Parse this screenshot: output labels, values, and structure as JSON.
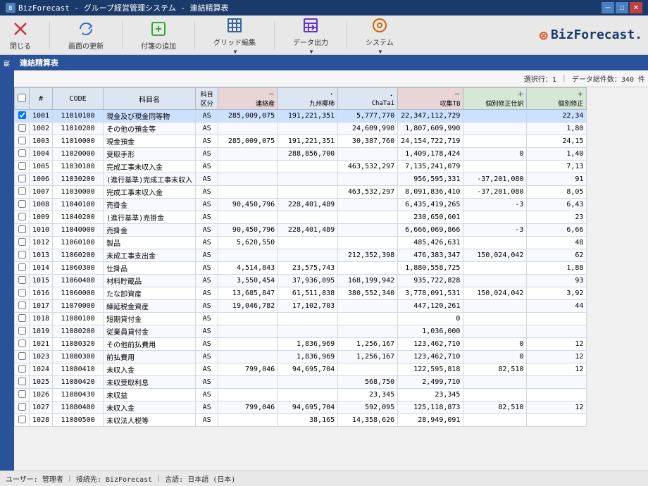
{
  "titleBar": {
    "title": "BizForecast - グループ経営管理システム - 連結精算表",
    "minBtn": "─",
    "maxBtn": "□",
    "closeBtn": "✕"
  },
  "toolbar": {
    "closeLabel": "閉じる",
    "refreshLabel": "画面の更新",
    "addLabel": "付箋の追加",
    "gridLabel": "グリッド編集",
    "exportLabel": "データ出力",
    "systemLabel": "システム",
    "logoText": "BizForecast."
  },
  "subHeader": {
    "title": "連結精算表"
  },
  "gridInfo": {
    "selectedRow": "選択行：1",
    "totalCount": "データ総件数：340 件"
  },
  "columns": {
    "check": "",
    "num": "#",
    "code": "CODE",
    "name": "科目名",
    "kubun": "科目区分",
    "renraku": "連絡産",
    "kyushu": "九州椰柿",
    "chatai": "ChaTai",
    "shuuhi": "収集TB",
    "kojin1": "個別修正仕訳",
    "kojin2": "個別修正"
  },
  "rows": [
    {
      "id": 1,
      "num": "1001",
      "code": "11010100",
      "name": "現金及び現金同等物",
      "kubun": "AS",
      "renraku": "285,009,075",
      "kyushu": "191,221,351",
      "chatai": "5,777,770",
      "shuuhi": "22,347,112,729",
      "kojin1": "",
      "kojin2": "22,34"
    },
    {
      "id": 2,
      "num": "1002",
      "code": "11010200",
      "name": "その他の預金等",
      "kubun": "AS",
      "renraku": "",
      "kyushu": "",
      "chatai": "24,609,990",
      "shuuhi": "1,807,609,990",
      "kojin1": "",
      "kojin2": "1,80"
    },
    {
      "id": 3,
      "num": "1003",
      "code": "11010000",
      "name": "現金預金",
      "kubun": "AS",
      "renraku": "285,009,075",
      "kyushu": "191,221,351",
      "chatai": "30,387,760",
      "shuuhi": "24,154,722,719",
      "kojin1": "",
      "kojin2": "24,15"
    },
    {
      "id": 4,
      "num": "1004",
      "code": "11020000",
      "name": "受取手形",
      "kubun": "AS",
      "renraku": "",
      "kyushu": "288,856,700",
      "chatai": "",
      "shuuhi": "1,409,178,424",
      "kojin1": "0",
      "kojin2": "1,40"
    },
    {
      "id": 5,
      "num": "1005",
      "code": "11030100",
      "name": "完成工事未収入金",
      "kubun": "AS",
      "renraku": "",
      "kyushu": "",
      "chatai": "463,532,297",
      "shuuhi": "7,135,241,079",
      "kojin1": "",
      "kojin2": "7,13"
    },
    {
      "id": 6,
      "num": "1006",
      "code": "11030200",
      "name": "(進行基準)完成工事未収入",
      "kubun": "AS",
      "renraku": "",
      "kyushu": "",
      "chatai": "",
      "shuuhi": "956,595,331",
      "kojin1": "-37,201,080",
      "kojin2": "91"
    },
    {
      "id": 7,
      "num": "1007",
      "code": "11030000",
      "name": "完成工事未収入金",
      "kubun": "AS",
      "renraku": "",
      "kyushu": "",
      "chatai": "463,532,297",
      "shuuhi": "8,091,836,410",
      "kojin1": "-37,201,080",
      "kojin2": "8,05"
    },
    {
      "id": 8,
      "num": "1008",
      "code": "11040100",
      "name": "売掛金",
      "kubun": "AS",
      "renraku": "90,450,796",
      "kyushu": "228,401,489",
      "chatai": "",
      "shuuhi": "6,435,419,265",
      "kojin1": "-3",
      "kojin2": "6,43"
    },
    {
      "id": 9,
      "num": "1009",
      "code": "11040200",
      "name": "(進行基準)売掛金",
      "kubun": "AS",
      "renraku": "",
      "kyushu": "",
      "chatai": "",
      "shuuhi": "230,650,601",
      "kojin1": "",
      "kojin2": "23"
    },
    {
      "id": 10,
      "num": "1010",
      "code": "11040000",
      "name": "売掛金",
      "kubun": "AS",
      "renraku": "90,450,796",
      "kyushu": "228,401,489",
      "chatai": "",
      "shuuhi": "6,666,069,866",
      "kojin1": "-3",
      "kojin2": "6,66"
    },
    {
      "id": 11,
      "num": "1012",
      "code": "11060100",
      "name": "製品",
      "kubun": "AS",
      "renraku": "5,620,550",
      "kyushu": "",
      "chatai": "",
      "shuuhi": "485,426,631",
      "kojin1": "",
      "kojin2": "48"
    },
    {
      "id": 12,
      "num": "1013",
      "code": "11060200",
      "name": "未成工事支出金",
      "kubun": "AS",
      "renraku": "",
      "kyushu": "",
      "chatai": "212,352,398",
      "shuuhi": "476,383,347",
      "kojin1": "150,024,042",
      "kojin2": "62"
    },
    {
      "id": 13,
      "num": "1014",
      "code": "11060300",
      "name": "仕掛品",
      "kubun": "AS",
      "renraku": "4,514,843",
      "kyushu": "23,575,743",
      "chatai": "",
      "shuuhi": "1,880,558,725",
      "kojin1": "",
      "kojin2": "1,88"
    },
    {
      "id": 14,
      "num": "1015",
      "code": "11060400",
      "name": "材料貯蔵品",
      "kubun": "AS",
      "renraku": "3,550,454",
      "kyushu": "37,936,095",
      "chatai": "168,199,942",
      "shuuhi": "935,722,828",
      "kojin1": "",
      "kojin2": "93"
    },
    {
      "id": 15,
      "num": "1016",
      "code": "11060000",
      "name": "たな卸資産",
      "kubun": "AS",
      "renraku": "13,685,847",
      "kyushu": "61,511,838",
      "chatai": "380,552,340",
      "shuuhi": "3,778,091,531",
      "kojin1": "150,024,042",
      "kojin2": "3,92"
    },
    {
      "id": 16,
      "num": "1017",
      "code": "11070000",
      "name": "繰延税金資産",
      "kubun": "AS",
      "renraku": "19,046,782",
      "kyushu": "17,102,703",
      "chatai": "",
      "shuuhi": "447,120,261",
      "kojin1": "",
      "kojin2": "44"
    },
    {
      "id": 17,
      "num": "1018",
      "code": "11080100",
      "name": "短期貸付金",
      "kubun": "AS",
      "renraku": "",
      "kyushu": "",
      "chatai": "",
      "shuuhi": "0",
      "kojin1": "",
      "kojin2": ""
    },
    {
      "id": 18,
      "num": "1019",
      "code": "11080200",
      "name": "従業員貸付金",
      "kubun": "AS",
      "renraku": "",
      "kyushu": "",
      "chatai": "",
      "shuuhi": "1,036,000",
      "kojin1": "",
      "kojin2": ""
    },
    {
      "id": 19,
      "num": "1021",
      "code": "11080320",
      "name": "その他前払費用",
      "kubun": "AS",
      "renraku": "",
      "kyushu": "1,836,969",
      "chatai": "1,256,167",
      "shuuhi": "123,462,710",
      "kojin1": "0",
      "kojin2": "12"
    },
    {
      "id": 20,
      "num": "1023",
      "code": "11080300",
      "name": "前払費用",
      "kubun": "AS",
      "renraku": "",
      "kyushu": "1,836,969",
      "chatai": "1,256,167",
      "shuuhi": "123,462,710",
      "kojin1": "0",
      "kojin2": "12"
    },
    {
      "id": 21,
      "num": "1024",
      "code": "11080410",
      "name": "未収入金",
      "kubun": "AS",
      "renraku": "799,046",
      "kyushu": "94,695,704",
      "chatai": "",
      "shuuhi": "122,595,818",
      "kojin1": "82,510",
      "kojin2": "12"
    },
    {
      "id": 22,
      "num": "1025",
      "code": "11080420",
      "name": "未収受取利息",
      "kubun": "AS",
      "renraku": "",
      "kyushu": "",
      "chatai": "568,750",
      "shuuhi": "2,499,710",
      "kojin1": "",
      "kojin2": ""
    },
    {
      "id": 23,
      "num": "1026",
      "code": "11080430",
      "name": "未収益",
      "kubun": "AS",
      "renraku": "",
      "kyushu": "",
      "chatai": "23,345",
      "shuuhi": "23,345",
      "kojin1": "",
      "kojin2": ""
    },
    {
      "id": 24,
      "num": "1027",
      "code": "11080400",
      "name": "未収入金",
      "kubun": "AS",
      "renraku": "799,046",
      "kyushu": "94,695,704",
      "chatai": "592,095",
      "shuuhi": "125,118,873",
      "kojin1": "82,510",
      "kojin2": "12"
    },
    {
      "id": 25,
      "num": "1028",
      "code": "11080500",
      "name": "未収法人税等",
      "kubun": "AS",
      "renraku": "",
      "kyushu": "38,165",
      "chatai": "14,358,626",
      "shuuhi": "28,949,091",
      "kojin1": "",
      "kojin2": ""
    }
  ],
  "statusBar": {
    "user": "ユーザー: 管理者",
    "connection": "接続先: BizForecast",
    "language": "言語: 日本語 (日本)"
  }
}
